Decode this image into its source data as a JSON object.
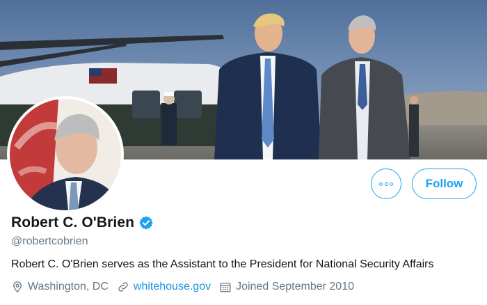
{
  "profile": {
    "name": "Robert C. O'Brien",
    "handle": "@robertcobrien",
    "bio": "Robert C. O'Brien serves as the Assistant to the President for National Security Affairs",
    "verified": true,
    "location": "Washington, DC",
    "website": "whitehouse.gov",
    "joined": "Joined September 2010"
  },
  "actions": {
    "follow_label": "Follow",
    "more_icon": "more-icon"
  },
  "icons": {
    "location": "location-pin-icon",
    "website": "link-icon",
    "joined": "calendar-icon",
    "verified": "verified-badge-icon"
  },
  "colors": {
    "accent": "#1da1f2",
    "link": "#1b95e0",
    "secondary_text": "#657786",
    "primary_text": "#14171a"
  }
}
